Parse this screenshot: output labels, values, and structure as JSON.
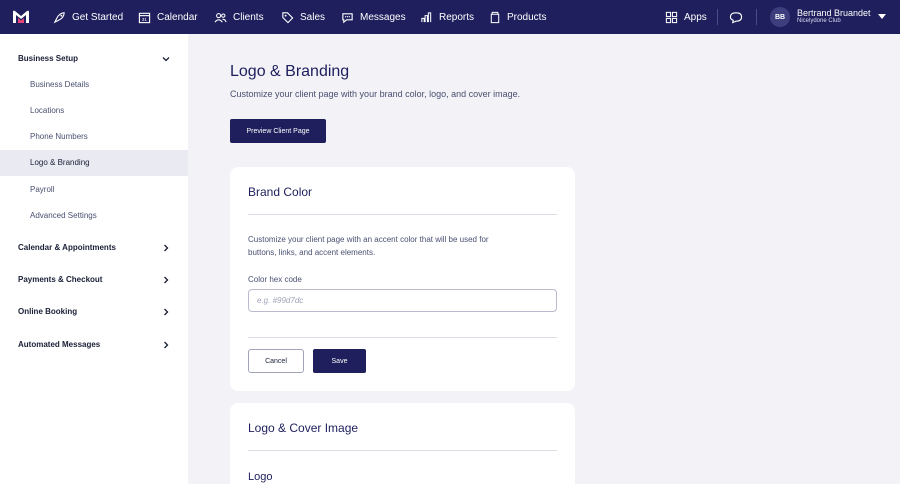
{
  "topnav": {
    "items": [
      {
        "label": "Get Started",
        "icon": "rocket-icon"
      },
      {
        "label": "Calendar",
        "icon": "calendar-icon"
      },
      {
        "label": "Clients",
        "icon": "clients-icon"
      },
      {
        "label": "Sales",
        "icon": "tag-icon"
      },
      {
        "label": "Messages",
        "icon": "chat-icon"
      },
      {
        "label": "Reports",
        "icon": "chart-icon"
      },
      {
        "label": "Products",
        "icon": "box-icon"
      }
    ],
    "apps_label": "Apps",
    "avatar_initials": "BB",
    "user_name": "Bertrand Bruandet",
    "business_name": "Nicelydone Club"
  },
  "sidebar": {
    "business_setup": "Business Setup",
    "sub_items": [
      "Business Details",
      "Locations",
      "Phone Numbers",
      "Logo & Branding",
      "Payroll",
      "Advanced Settings"
    ],
    "active_index": 3,
    "sections": [
      "Calendar & Appointments",
      "Payments & Checkout",
      "Online Booking",
      "Automated Messages"
    ]
  },
  "main": {
    "title": "Logo & Branding",
    "subtitle": "Customize your client page with your brand color, logo, and cover image.",
    "preview_button": "Preview Client Page",
    "brand_card": {
      "title": "Brand Color",
      "description": "Customize your client page with an accent color that will be used for buttons, links, and accent elements.",
      "field_label": "Color hex code",
      "field_value": "",
      "field_placeholder": "e.g. #99d7dc",
      "cancel": "Cancel",
      "save": "Save"
    },
    "cover_card": {
      "title": "Logo & Cover Image",
      "logo_label": "Logo"
    }
  },
  "colors": {
    "nav_bg": "#1e1f5c",
    "accent": "#1e1f5c",
    "page_bg": "#f2f2f7"
  }
}
